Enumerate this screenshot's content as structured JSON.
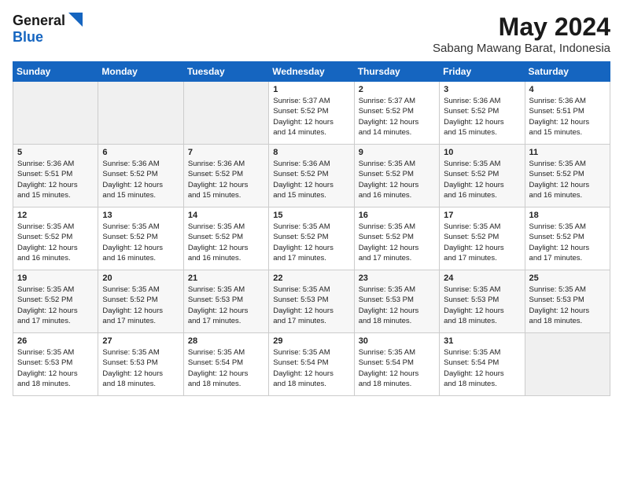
{
  "logo": {
    "general": "General",
    "blue": "Blue"
  },
  "title": "May 2024",
  "subtitle": "Sabang Mawang Barat, Indonesia",
  "days_of_week": [
    "Sunday",
    "Monday",
    "Tuesday",
    "Wednesday",
    "Thursday",
    "Friday",
    "Saturday"
  ],
  "weeks": [
    [
      {
        "day": "",
        "info": ""
      },
      {
        "day": "",
        "info": ""
      },
      {
        "day": "",
        "info": ""
      },
      {
        "day": "1",
        "info": "Sunrise: 5:37 AM\nSunset: 5:52 PM\nDaylight: 12 hours\nand 14 minutes."
      },
      {
        "day": "2",
        "info": "Sunrise: 5:37 AM\nSunset: 5:52 PM\nDaylight: 12 hours\nand 14 minutes."
      },
      {
        "day": "3",
        "info": "Sunrise: 5:36 AM\nSunset: 5:52 PM\nDaylight: 12 hours\nand 15 minutes."
      },
      {
        "day": "4",
        "info": "Sunrise: 5:36 AM\nSunset: 5:51 PM\nDaylight: 12 hours\nand 15 minutes."
      }
    ],
    [
      {
        "day": "5",
        "info": "Sunrise: 5:36 AM\nSunset: 5:51 PM\nDaylight: 12 hours\nand 15 minutes."
      },
      {
        "day": "6",
        "info": "Sunrise: 5:36 AM\nSunset: 5:52 PM\nDaylight: 12 hours\nand 15 minutes."
      },
      {
        "day": "7",
        "info": "Sunrise: 5:36 AM\nSunset: 5:52 PM\nDaylight: 12 hours\nand 15 minutes."
      },
      {
        "day": "8",
        "info": "Sunrise: 5:36 AM\nSunset: 5:52 PM\nDaylight: 12 hours\nand 15 minutes."
      },
      {
        "day": "9",
        "info": "Sunrise: 5:35 AM\nSunset: 5:52 PM\nDaylight: 12 hours\nand 16 minutes."
      },
      {
        "day": "10",
        "info": "Sunrise: 5:35 AM\nSunset: 5:52 PM\nDaylight: 12 hours\nand 16 minutes."
      },
      {
        "day": "11",
        "info": "Sunrise: 5:35 AM\nSunset: 5:52 PM\nDaylight: 12 hours\nand 16 minutes."
      }
    ],
    [
      {
        "day": "12",
        "info": "Sunrise: 5:35 AM\nSunset: 5:52 PM\nDaylight: 12 hours\nand 16 minutes."
      },
      {
        "day": "13",
        "info": "Sunrise: 5:35 AM\nSunset: 5:52 PM\nDaylight: 12 hours\nand 16 minutes."
      },
      {
        "day": "14",
        "info": "Sunrise: 5:35 AM\nSunset: 5:52 PM\nDaylight: 12 hours\nand 16 minutes."
      },
      {
        "day": "15",
        "info": "Sunrise: 5:35 AM\nSunset: 5:52 PM\nDaylight: 12 hours\nand 17 minutes."
      },
      {
        "day": "16",
        "info": "Sunrise: 5:35 AM\nSunset: 5:52 PM\nDaylight: 12 hours\nand 17 minutes."
      },
      {
        "day": "17",
        "info": "Sunrise: 5:35 AM\nSunset: 5:52 PM\nDaylight: 12 hours\nand 17 minutes."
      },
      {
        "day": "18",
        "info": "Sunrise: 5:35 AM\nSunset: 5:52 PM\nDaylight: 12 hours\nand 17 minutes."
      }
    ],
    [
      {
        "day": "19",
        "info": "Sunrise: 5:35 AM\nSunset: 5:52 PM\nDaylight: 12 hours\nand 17 minutes."
      },
      {
        "day": "20",
        "info": "Sunrise: 5:35 AM\nSunset: 5:52 PM\nDaylight: 12 hours\nand 17 minutes."
      },
      {
        "day": "21",
        "info": "Sunrise: 5:35 AM\nSunset: 5:53 PM\nDaylight: 12 hours\nand 17 minutes."
      },
      {
        "day": "22",
        "info": "Sunrise: 5:35 AM\nSunset: 5:53 PM\nDaylight: 12 hours\nand 17 minutes."
      },
      {
        "day": "23",
        "info": "Sunrise: 5:35 AM\nSunset: 5:53 PM\nDaylight: 12 hours\nand 18 minutes."
      },
      {
        "day": "24",
        "info": "Sunrise: 5:35 AM\nSunset: 5:53 PM\nDaylight: 12 hours\nand 18 minutes."
      },
      {
        "day": "25",
        "info": "Sunrise: 5:35 AM\nSunset: 5:53 PM\nDaylight: 12 hours\nand 18 minutes."
      }
    ],
    [
      {
        "day": "26",
        "info": "Sunrise: 5:35 AM\nSunset: 5:53 PM\nDaylight: 12 hours\nand 18 minutes."
      },
      {
        "day": "27",
        "info": "Sunrise: 5:35 AM\nSunset: 5:53 PM\nDaylight: 12 hours\nand 18 minutes."
      },
      {
        "day": "28",
        "info": "Sunrise: 5:35 AM\nSunset: 5:54 PM\nDaylight: 12 hours\nand 18 minutes."
      },
      {
        "day": "29",
        "info": "Sunrise: 5:35 AM\nSunset: 5:54 PM\nDaylight: 12 hours\nand 18 minutes."
      },
      {
        "day": "30",
        "info": "Sunrise: 5:35 AM\nSunset: 5:54 PM\nDaylight: 12 hours\nand 18 minutes."
      },
      {
        "day": "31",
        "info": "Sunrise: 5:35 AM\nSunset: 5:54 PM\nDaylight: 12 hours\nand 18 minutes."
      },
      {
        "day": "",
        "info": ""
      }
    ]
  ]
}
